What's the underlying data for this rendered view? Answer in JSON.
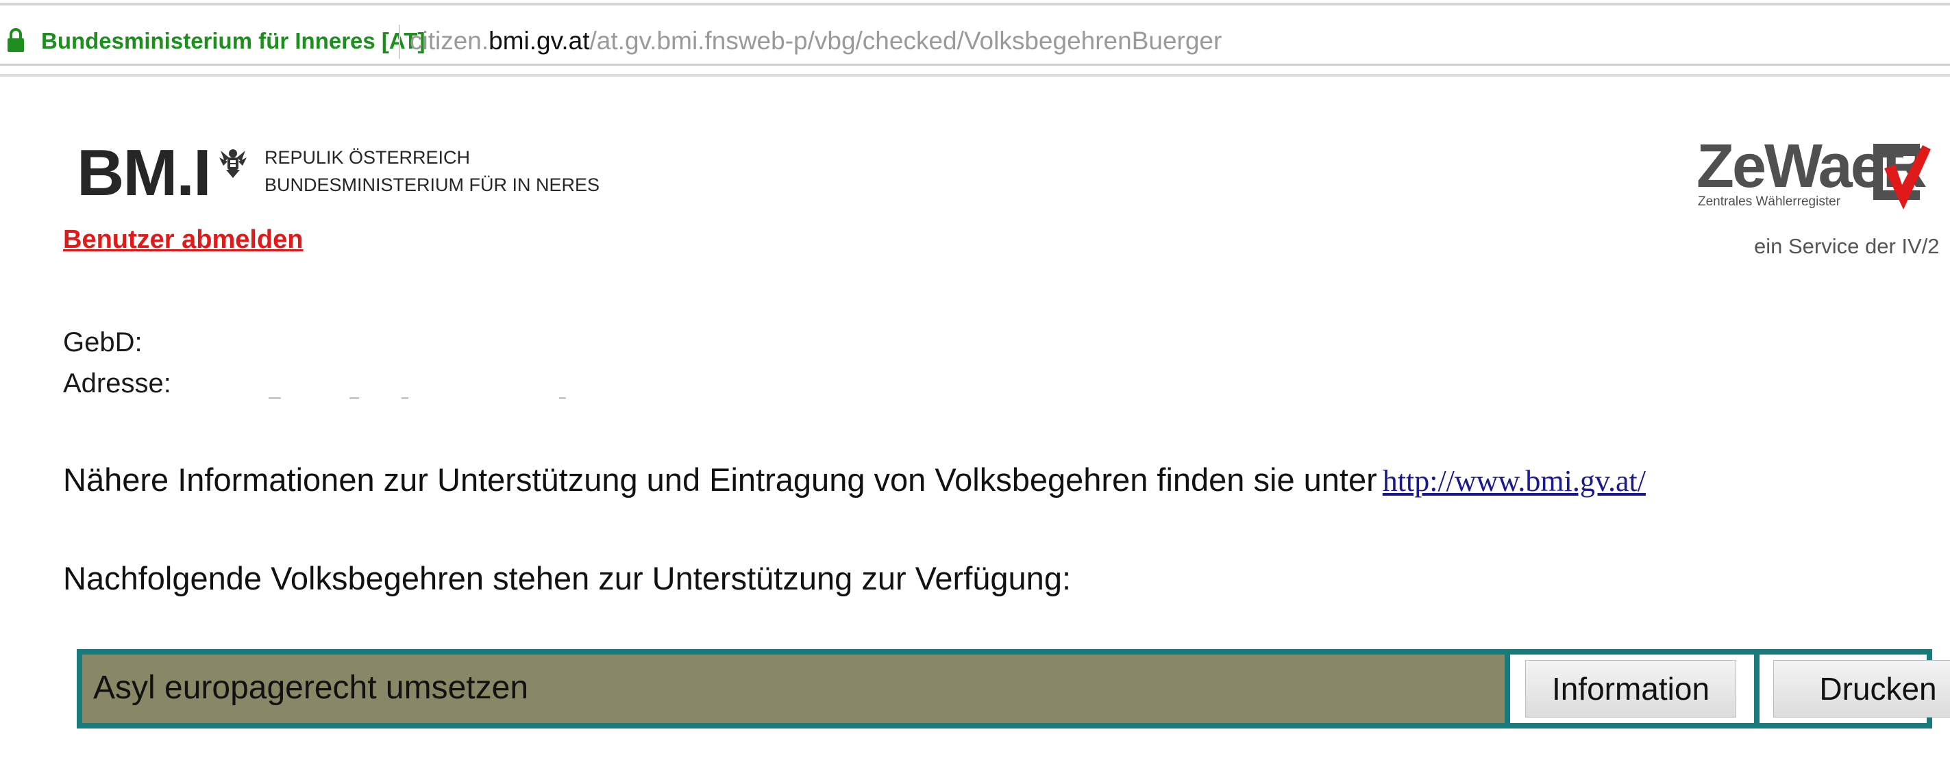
{
  "browser": {
    "site_identity": "Bundesministerium für Inneres [AT]",
    "url_prefix": "citizen.",
    "url_domain": "bmi.gv.at",
    "url_path": "/at.gv.bmi.fnsweb-p/vbg/checked/VolksbegehrenBuerger",
    "lock_icon": "lock-icon",
    "lock_color": "#1e8e1e"
  },
  "header": {
    "bmi_logo": "BM.I",
    "ministry_line1": "REPULIK ÖSTERREICH",
    "ministry_line2": "BUNDESMINISTERIUM FÜR IN NERES",
    "logout_label": "Benutzer abmelden",
    "zewaer_logo": "ZeWaeR",
    "zewaer_subtitle": "Zentrales Wählerregister",
    "service_text": "ein Service der IV/2"
  },
  "user": {
    "birthdate_label": "GebD:",
    "address_label": "Adresse:"
  },
  "content": {
    "info_text": "Nähere Informationen zur Unterstützung und Eintragung von Volksbegehren finden sie unter",
    "info_link": "http://www.bmi.gv.at/",
    "list_heading": "Nachfolgende Volksbegehren stehen zur Unterstützung zur Verfügung:"
  },
  "petitions": [
    {
      "name": "Asyl europagerecht umsetzen",
      "info_button": "Information",
      "print_button": "Drucken"
    }
  ],
  "colors": {
    "accent_green": "#1e8e1e",
    "logout_red": "#e01919",
    "row_border_teal": "#187a7a",
    "row_fill_olive": "#888866",
    "link_blue": "#1a1a8c"
  }
}
